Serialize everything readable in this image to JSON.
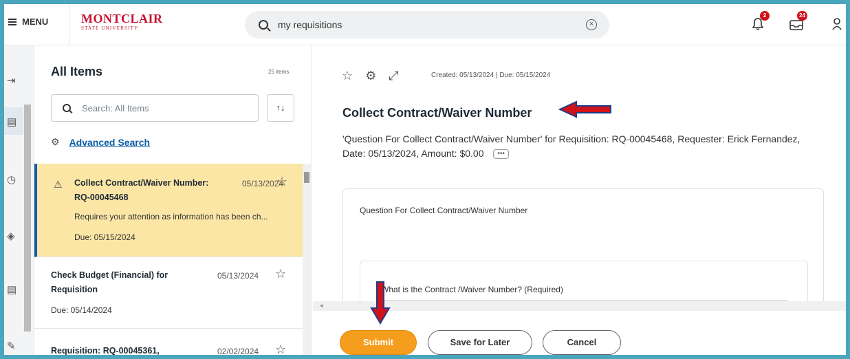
{
  "header": {
    "menu_label": "MENU",
    "logo_line1": "MONTCLAIR",
    "logo_line2": "STATE UNIVERSITY",
    "search_value": "my requisitions",
    "notification_count": "2",
    "inbox_count": "24"
  },
  "list": {
    "title": "All Items",
    "count": "25 items",
    "search_placeholder": "Search: All Items",
    "advanced_search": "Advanced Search",
    "items": [
      {
        "title_line1": "Collect Contract/Waiver Number:",
        "title_line2": "RQ-00045468",
        "date": "05/13/2024",
        "subtitle": "Requires your attention as information has been ch...",
        "due": "Due: 05/15/2024"
      },
      {
        "title_line1": "Check Budget (Financial) for",
        "title_line2": "Requisition",
        "date": "05/13/2024",
        "due": "Due: 05/14/2024"
      },
      {
        "title_line1": "Requisition: RQ-00045361,",
        "date": "02/02/2024"
      }
    ]
  },
  "detail": {
    "meta": "Created: 05/13/2024 | Due: 05/15/2024",
    "title": "Collect Contract/Waiver Number",
    "description": "'Question For Collect Contract/Waiver Number' for Requisition: RQ-00045468, Requester: Erick Fernandez, Date: 05/13/2024, Amount: $0.00",
    "more_label": "•••",
    "card_label": "Question For Collect Contract/Waiver Number",
    "question_label": "What is the Contract /Waiver Number? (Required)"
  },
  "actions": {
    "submit": "Submit",
    "save_for_later": "Save for Later",
    "cancel": "Cancel"
  },
  "colors": {
    "frame_border": "#4aa6bd",
    "selected_item_bg": "#fbe6a6",
    "submit_button": "#f59d1c",
    "brand_red": "#c8102e",
    "annotation_arrow": "#d0121b"
  }
}
